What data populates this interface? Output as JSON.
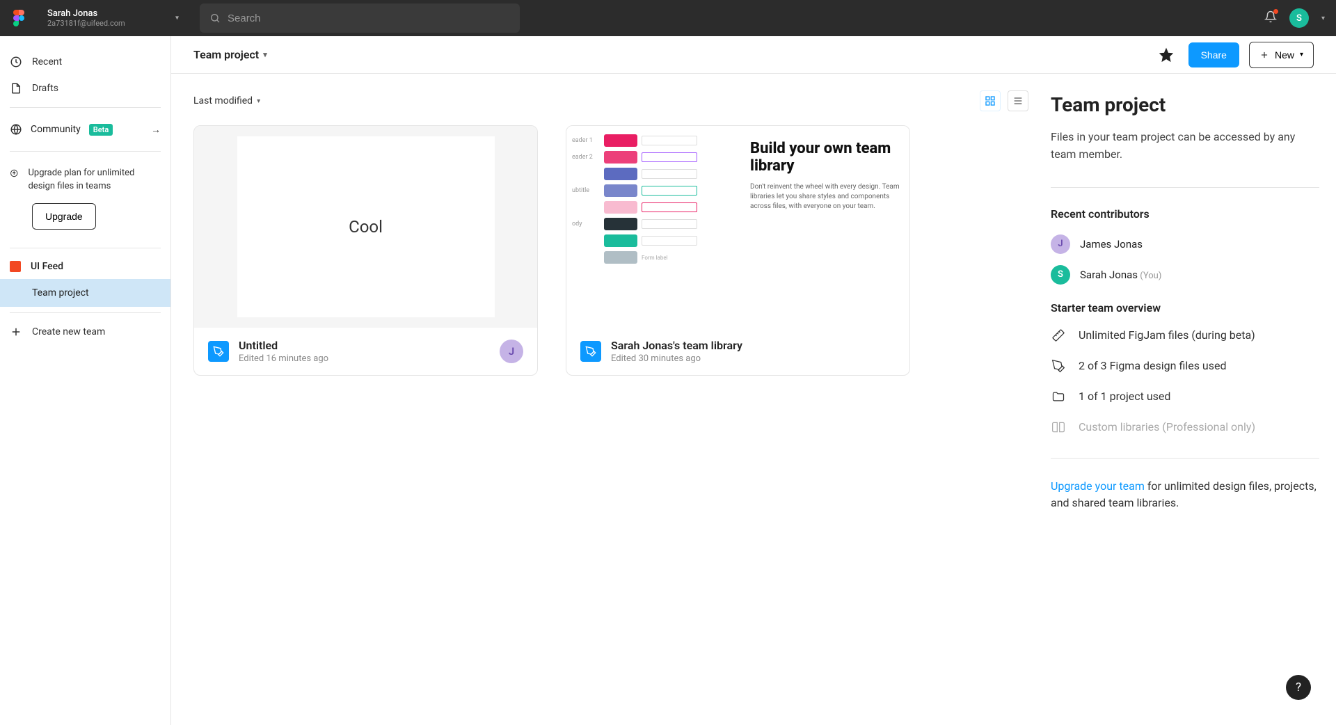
{
  "topbar": {
    "user_name": "Sarah Jonas",
    "user_email": "2a73181f@uifeed.com",
    "search_placeholder": "Search",
    "avatar_initial": "S"
  },
  "sidebar": {
    "recent": "Recent",
    "drafts": "Drafts",
    "community": "Community",
    "beta": "Beta",
    "upgrade_text": "Upgrade plan for unlimited design files in teams",
    "upgrade_button": "Upgrade",
    "team_name": "UI Feed",
    "project_name": "Team project",
    "create_team": "Create new team"
  },
  "header": {
    "breadcrumb": "Team project",
    "share": "Share",
    "new": "New"
  },
  "files": {
    "sort": "Last modified",
    "cards": [
      {
        "title": "Untitled",
        "subtitle": "Edited 16 minutes ago",
        "thumb_text": "Cool",
        "contributor_initial": "J"
      },
      {
        "title": "Sarah Jonas's team library",
        "subtitle": "Edited 30 minutes ago",
        "lib_heading": "Build your own team library",
        "lib_body": "Don't reinvent the wheel with every design. Team libraries let you share styles and components across files, with everyone on your team."
      }
    ]
  },
  "panel": {
    "title": "Team project",
    "description": "Files in your team project can be accessed by any team member.",
    "recent_h": "Recent contributors",
    "contributors": [
      {
        "initial": "J",
        "name": "James Jonas",
        "color": "#c5b3e6",
        "fg": "#6b4caf",
        "you": ""
      },
      {
        "initial": "S",
        "name": "Sarah Jonas",
        "color": "#1abc9c",
        "fg": "#fff",
        "you": "(You)"
      }
    ],
    "overview_h": "Starter team overview",
    "ov": [
      "Unlimited FigJam files (during beta)",
      "2 of 3 Figma design files used",
      "1 of 1 project used",
      "Custom libraries (Professional only)"
    ],
    "upgrade_link": "Upgrade your team",
    "upgrade_rest": " for unlimited design files, projects, and shared team libraries."
  },
  "colors": {
    "accent": "#0d99ff",
    "green": "#1abc9c",
    "red": "#f24822"
  }
}
